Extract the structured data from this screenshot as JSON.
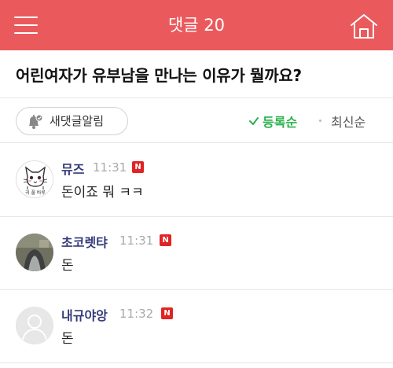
{
  "header": {
    "title": "댓글 20",
    "menu_icon": "hamburger-menu-icon",
    "home_icon": "home-icon",
    "bar_color": "#ea5a5d"
  },
  "post": {
    "title": "어린여자가 유부남을 만나는 이유가 뭘까요?"
  },
  "toolbar": {
    "notify_label": "새댓글알림",
    "notify_icon": "bell-icon",
    "sort_registered_label": "등록순",
    "sort_latest_label": "최신순",
    "active_sort_color": "#2ab14d",
    "check_icon": "check-icon"
  },
  "comments": [
    {
      "author": "뮤즈",
      "time": "11:31",
      "new_badge": "N",
      "text": "돈이죠 뭐 ㅋㅋ",
      "avatar": "cat-sketch-avatar",
      "avatar_caption": "귀 풀 바루"
    },
    {
      "author": "초코렛탸",
      "time": "11:31",
      "new_badge": "N",
      "text": "돈",
      "avatar": "photo-avatar"
    },
    {
      "author": "내규야앙",
      "time": "11:32",
      "new_badge": "N",
      "text": "돈",
      "avatar": "default-person-avatar"
    }
  ],
  "colors": {
    "author": "#333a7a",
    "badge": "#e02424"
  }
}
